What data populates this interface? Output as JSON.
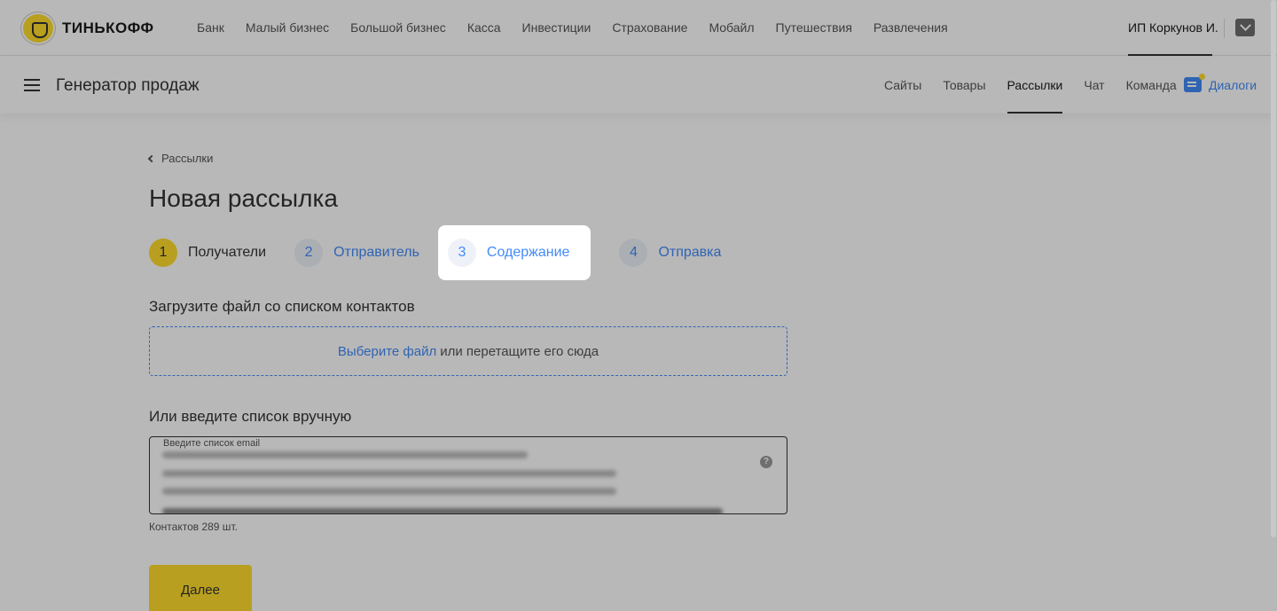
{
  "brand": {
    "logo_text": "ТИНЬКОФФ"
  },
  "topnav": {
    "items": [
      "Банк",
      "Малый бизнес",
      "Большой бизнес",
      "Касса",
      "Инвестиции",
      "Страхование",
      "Мобайл",
      "Путешествия",
      "Развлечения"
    ],
    "user": "ИП Коркунов И."
  },
  "header": {
    "product_title": "Генератор продаж",
    "nav": [
      "Сайты",
      "Товары",
      "Рассылки",
      "Чат",
      "Команда"
    ],
    "active_nav": "Рассылки",
    "dialogs_label": "Диалоги"
  },
  "breadcrumb": {
    "label": "Рассылки"
  },
  "page": {
    "title": "Новая рассылка"
  },
  "steps": [
    {
      "num": "1",
      "label": "Получатели",
      "state": "done"
    },
    {
      "num": "2",
      "label": "Отправитель",
      "state": "pending"
    },
    {
      "num": "3",
      "label": "Содержание",
      "state": "highlighted"
    },
    {
      "num": "4",
      "label": "Отправка",
      "state": "pending"
    }
  ],
  "upload": {
    "title": "Загрузите файл со списком контактов",
    "link": "Выберите файл",
    "hint": "или перетащите его сюда"
  },
  "manual": {
    "title": "Или введите список вручную",
    "field_label": "Введите список email",
    "contacts_count": "Контактов 289 шт."
  },
  "actions": {
    "next_label": "Далее"
  },
  "colors": {
    "accent": "#ffdd2d",
    "link": "#428bf9",
    "text": "#333333"
  }
}
